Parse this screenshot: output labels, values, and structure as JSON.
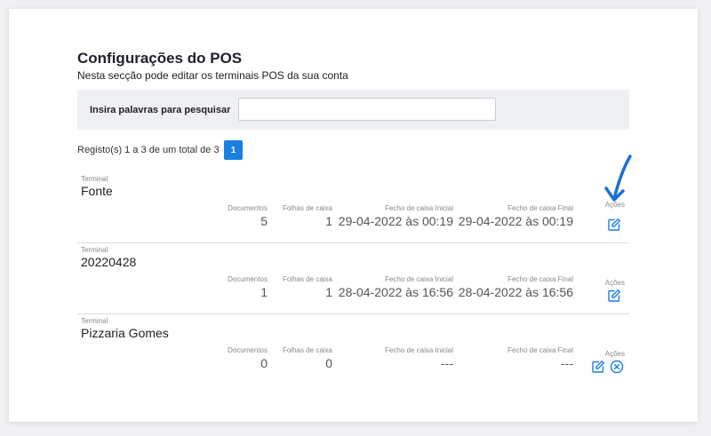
{
  "page": {
    "title": "Configurações do POS",
    "subtitle": "Nesta secção pode editar os terminais POS da sua conta"
  },
  "search": {
    "label": "Insira palavras para pesquisar",
    "value": "",
    "placeholder": ""
  },
  "pagination": {
    "records_info": "Registo(s) 1 a 3 de um total de 3",
    "current_page": "1"
  },
  "columns": {
    "terminal": "Terminal",
    "documentos": "Documentos",
    "folhas": "Folhas de caixa",
    "fecho_inicial": "Fecho de caixa Inicial",
    "fecho_final": "Fecho de caixa Final",
    "acoes": "Ações"
  },
  "terminals": [
    {
      "name": "Fonte",
      "documentos": "5",
      "folhas": "1",
      "fecho_inicial": "29-04-2022 às 00:19",
      "fecho_final": "29-04-2022 às 00:19",
      "actions": [
        "edit-icon"
      ]
    },
    {
      "name": "20220428",
      "documentos": "1",
      "folhas": "1",
      "fecho_inicial": "28-04-2022 às 16:56",
      "fecho_final": "28-04-2022 às 16:56",
      "actions": [
        "edit-icon"
      ]
    },
    {
      "name": "Pizzaria Gomes",
      "documentos": "0",
      "folhas": "0",
      "fecho_inicial": "---",
      "fecho_final": "---",
      "actions": [
        "edit-icon",
        "delete-icon"
      ]
    }
  ],
  "colors": {
    "accent": "#1a7fe0",
    "panel": "#eef0f4",
    "annotation_arrow": "#1a6fd8"
  }
}
